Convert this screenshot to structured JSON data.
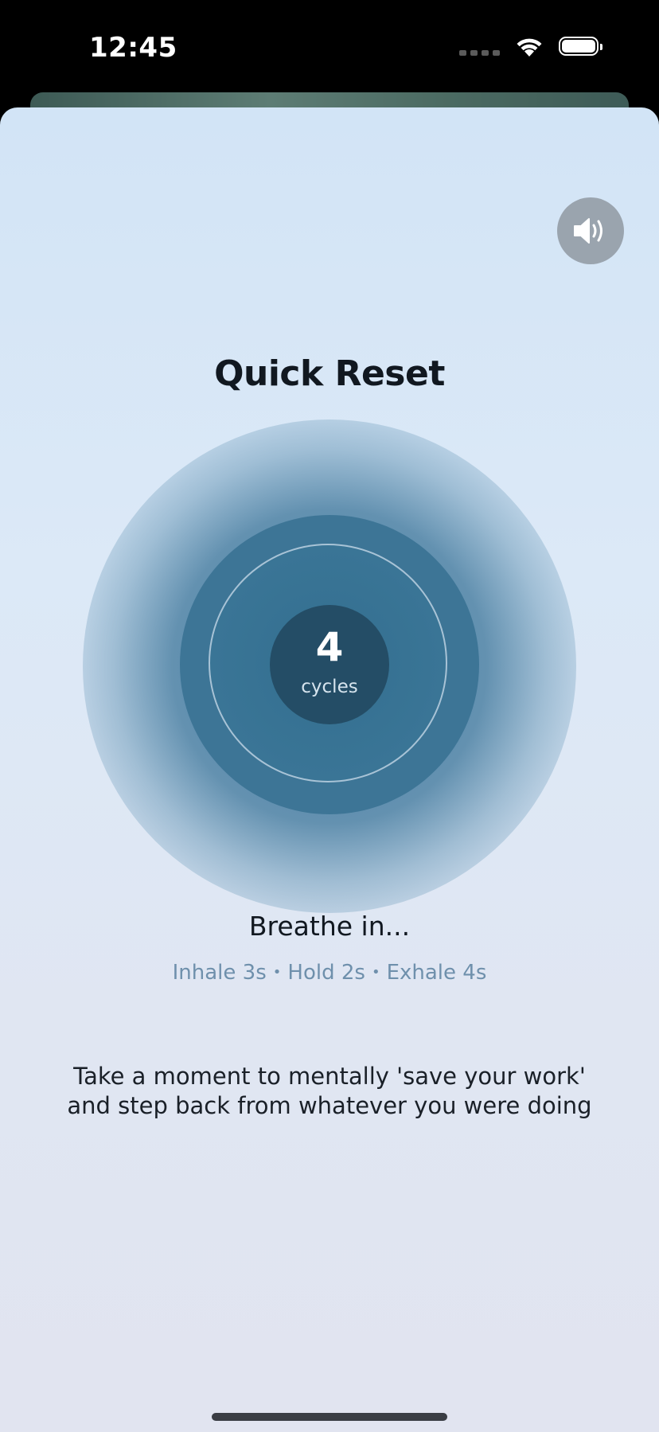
{
  "status_bar": {
    "time": "12:45",
    "icons": [
      "cellular-dots-icon",
      "wifi-icon",
      "battery-icon"
    ]
  },
  "sheet": {
    "sound_icon": "speaker-volume-icon",
    "title": "Quick Reset",
    "counter": {
      "value": "4",
      "label": "cycles"
    },
    "phase": "Breathe in...",
    "timing": {
      "inhale": "Inhale 3s",
      "hold": "Hold 2s",
      "exhale": "Exhale 4s",
      "separator": "•"
    },
    "description": "Take a moment to mentally 'save your work' and step back from whatever you were doing"
  },
  "colors": {
    "background_top": "#d2e4f6",
    "background_bottom": "#e1e4f0",
    "circle_outer": "#3d7596",
    "circle_inner": "#244d66",
    "timing_text": "#6f90ac",
    "sound_button": "#9aa4ae"
  }
}
